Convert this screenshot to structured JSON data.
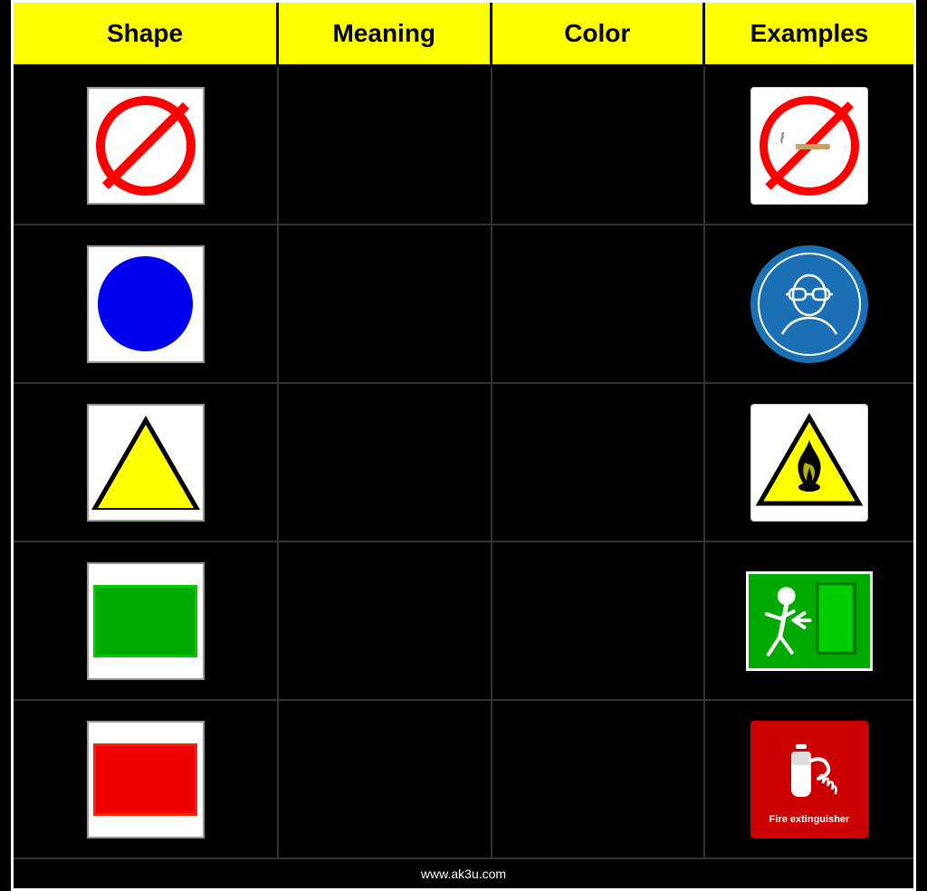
{
  "header": {
    "col1": "Shape",
    "col2": "Meaning",
    "col3": "Color",
    "col4": "Examples"
  },
  "rows": [
    {
      "shape": "circle-with-slash",
      "meaning": "",
      "color": "",
      "example": "no-smoking"
    },
    {
      "shape": "blue-circle",
      "meaning": "",
      "color": "",
      "example": "safety-glasses"
    },
    {
      "shape": "yellow-triangle",
      "meaning": "",
      "color": "",
      "example": "flammable"
    },
    {
      "shape": "green-rectangle",
      "meaning": "",
      "color": "",
      "example": "emergency-exit"
    },
    {
      "shape": "red-rectangle",
      "meaning": "",
      "color": "",
      "example": "fire-extinguisher"
    }
  ],
  "watermark": "www.ak3u.com",
  "fire_extinguisher_label": "Fire extinguisher"
}
